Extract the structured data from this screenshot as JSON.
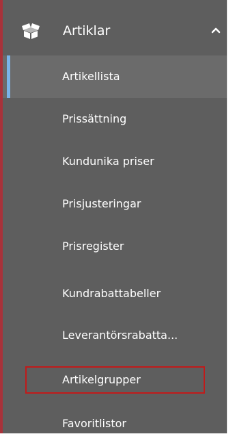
{
  "sidebar": {
    "section": {
      "label": "Artiklar",
      "icon": "boxes-icon",
      "expanded": true
    },
    "items": [
      {
        "label": "Artikellista",
        "active": true
      },
      {
        "label": "Prissättning"
      },
      {
        "label": "Kundunika priser"
      },
      {
        "label": "Prisjusteringar"
      },
      {
        "label": "Prisregister"
      },
      {
        "label": "Kundrabattabeller"
      },
      {
        "label": "Leverantörsrabatta..."
      },
      {
        "label": "Artikelgrupper",
        "highlighted": true
      },
      {
        "label": "Favoritlistor"
      }
    ]
  },
  "colors": {
    "sidebar_bg": "#5e5e5e",
    "active_bg": "#6b6b6b",
    "active_indicator": "#79b4ea",
    "text": "#ffffff",
    "highlight_border": "#c11a1a",
    "left_edge": "#a8323a"
  }
}
